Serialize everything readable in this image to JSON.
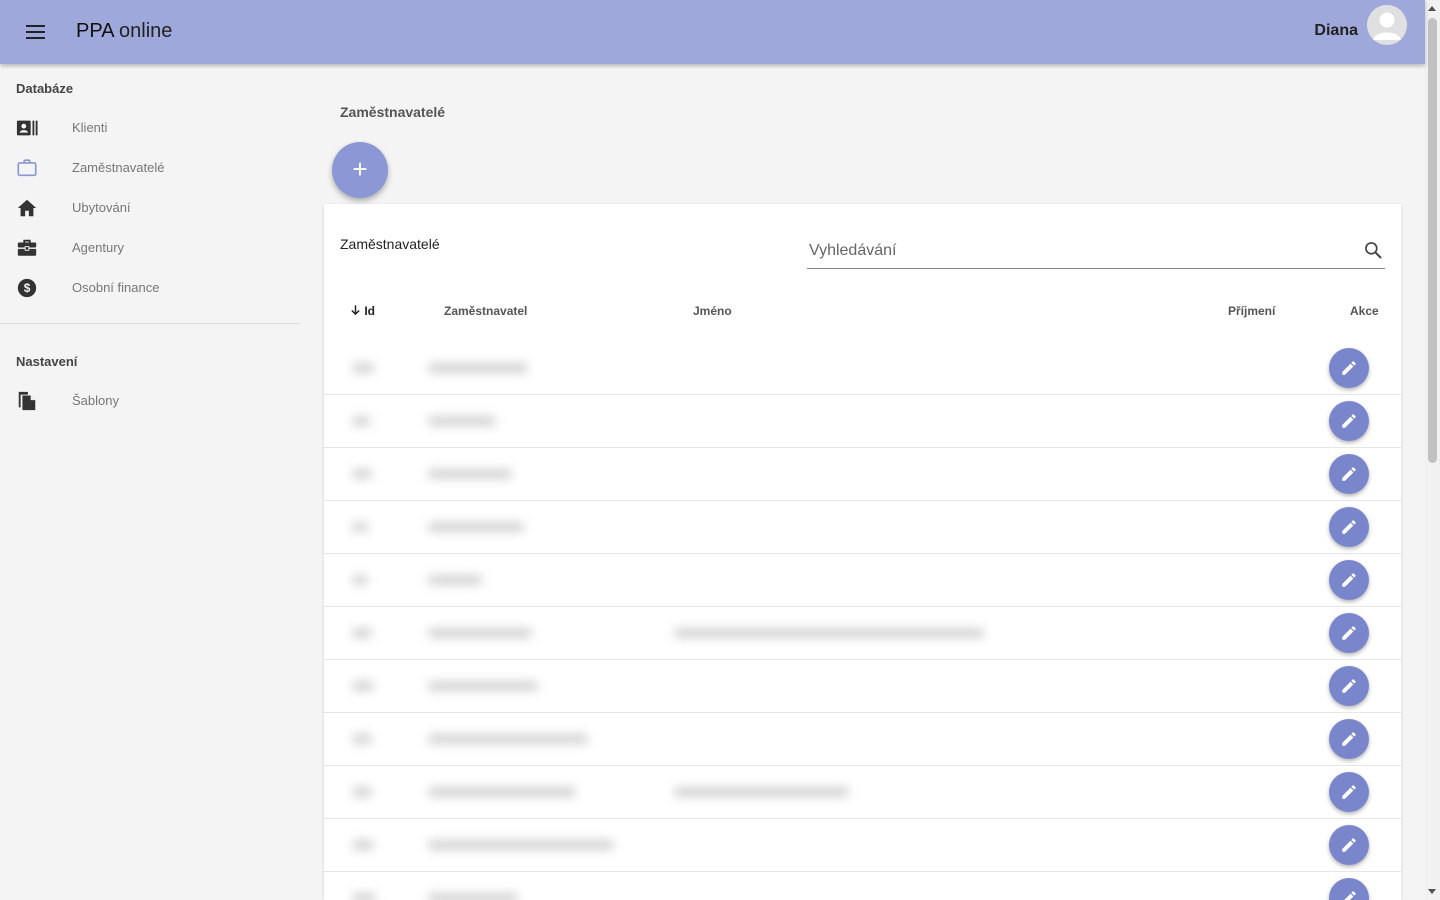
{
  "app": {
    "brand_bold": "PPA",
    "brand_light": "online",
    "user_name": "Diana"
  },
  "sidebar": {
    "section_database": "Databáze",
    "items": [
      {
        "label": "Klienti",
        "icon": "contacts-card-icon"
      },
      {
        "label": "Zaměstnavatelé",
        "icon": "briefcase-outline-icon"
      },
      {
        "label": "Ubytování",
        "icon": "home-icon"
      },
      {
        "label": "Agentury",
        "icon": "toolbox-icon"
      },
      {
        "label": "Osobní finance",
        "icon": "dollar-circle-icon"
      }
    ],
    "section_settings": "Nastavení",
    "settings_items": [
      {
        "label": "Šablony",
        "icon": "file-copy-icon"
      }
    ]
  },
  "main": {
    "page_title": "Zaměstnavatelé",
    "add_button": "+",
    "table_title": "Zaměstnavatelé",
    "search": {
      "placeholder": "Vyhledávání",
      "value": ""
    },
    "columns": {
      "id": "Id",
      "employer": "Zaměstnavatel",
      "first_name": "Jméno",
      "last_name": "Příjmení",
      "actions": "Akce"
    },
    "sort": {
      "column": "Id",
      "direction": "desc"
    }
  },
  "colors": {
    "appbar": "#9fa8da",
    "accent": "#7986cb",
    "fab": "#8c97d6"
  }
}
